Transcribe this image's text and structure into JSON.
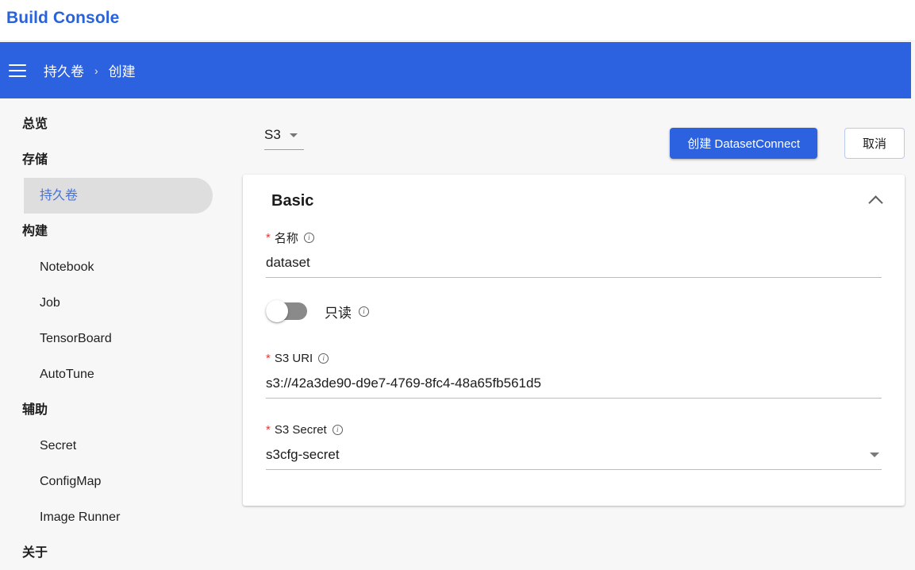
{
  "brand": {
    "title": "Build Console"
  },
  "topbar": {
    "menu_icon": "hamburger-icon",
    "breadcrumb": [
      {
        "label": "持久卷"
      },
      {
        "label": "创建"
      }
    ],
    "separator": "›"
  },
  "sidebar": {
    "items": [
      {
        "label": "总览",
        "type": "group",
        "selected": false
      },
      {
        "label": "存储",
        "type": "group",
        "selected": false
      },
      {
        "label": "持久卷",
        "type": "item",
        "selected": true
      },
      {
        "label": "构建",
        "type": "group",
        "selected": false
      },
      {
        "label": "Notebook",
        "type": "item",
        "selected": false
      },
      {
        "label": "Job",
        "type": "item",
        "selected": false
      },
      {
        "label": "TensorBoard",
        "type": "item",
        "selected": false
      },
      {
        "label": "AutoTune",
        "type": "item",
        "selected": false
      },
      {
        "label": "辅助",
        "type": "group",
        "selected": false
      },
      {
        "label": "Secret",
        "type": "item",
        "selected": false
      },
      {
        "label": "ConfigMap",
        "type": "item",
        "selected": false
      },
      {
        "label": "Image Runner",
        "type": "item",
        "selected": false
      },
      {
        "label": "关于",
        "type": "group",
        "selected": false
      }
    ]
  },
  "actions": {
    "type_select": {
      "value": "S3",
      "icon": "caret-down-icon"
    },
    "primary_button": "创建 DatasetConnect",
    "secondary_button": "取消"
  },
  "card": {
    "title": "Basic",
    "collapse_icon": "chevron-up-icon",
    "fields": {
      "name": {
        "required": "*",
        "label": "名称",
        "info_icon": "info-icon",
        "value": "dataset"
      },
      "readonly": {
        "label": "只读",
        "info_icon": "info-icon",
        "toggle_state": "off"
      },
      "s3_uri": {
        "required": "*",
        "label": "S3 URI",
        "info_icon": "info-icon",
        "value": "s3://42a3de90-d9e7-4769-8fc4-48a65fb561d5"
      },
      "s3_secret": {
        "required": "*",
        "label": "S3 Secret",
        "info_icon": "info-icon",
        "value": "s3cfg-secret",
        "dropdown_icon": "caret-down-icon"
      }
    }
  },
  "colors": {
    "brand_blue": "#2962d9",
    "topbar_blue": "#2c62e0",
    "page_bg": "#f7f7f7",
    "card_bg": "#ffffff",
    "selected_nav_bg": "#dedede",
    "selected_nav_text": "#4a73d6",
    "required_red": "#e53935"
  }
}
